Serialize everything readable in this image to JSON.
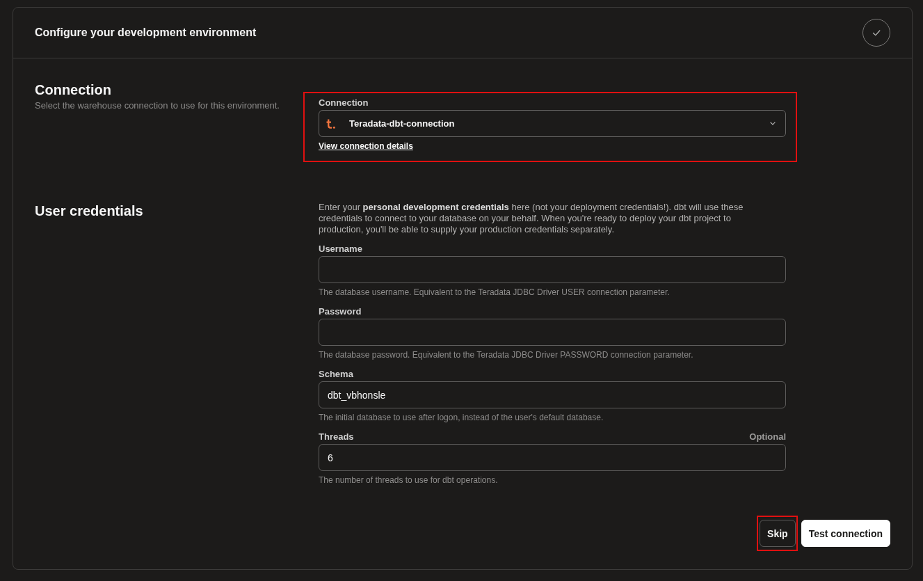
{
  "header": {
    "title": "Configure your development environment",
    "completed": true
  },
  "sections": [
    {
      "title": "Connection",
      "description": "Select the warehouse connection to use for this environment.",
      "highlighted": true,
      "fields": [
        {
          "kind": "select",
          "label": "Connection",
          "value": "Teradata-dbt-connection",
          "link": "View connection details"
        }
      ]
    },
    {
      "title": "User credentials",
      "intro": "Enter your **personal development credentials** here (not your deployment credentials!). dbt will use these credentials to connect to your database on your behalf. When you're ready to deploy your dbt project to production, you'll be able to supply your production credentials separately.",
      "highlighted": false,
      "fields": [
        {
          "kind": "text",
          "label": "Username",
          "help": "The database username. Equivalent to the Teradata JDBC Driver USER connection parameter."
        },
        {
          "kind": "text",
          "label": "Password",
          "help": "The database password. Equivalent to the Teradata JDBC Driver PASSWORD connection parameter."
        },
        {
          "kind": "text",
          "label": "Schema",
          "value": "dbt_vbhonsle",
          "help": "The initial database to use after logon, instead of the user's default database."
        },
        {
          "kind": "text",
          "label": "Threads",
          "note": "Optional",
          "value": "6",
          "help": "The number of threads to use for dbt operations."
        }
      ]
    }
  ],
  "buttons": [
    {
      "label": "Skip",
      "kind": "outline",
      "highlighted": true
    },
    {
      "label": "Test connection",
      "kind": "solid",
      "highlighted": false
    }
  ]
}
